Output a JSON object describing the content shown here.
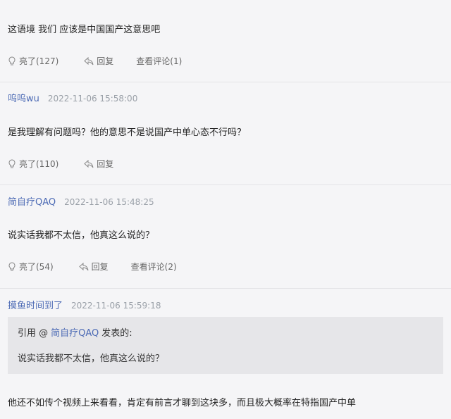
{
  "comments": [
    {
      "text": "这语境 我们 应该是中国国产这意思吧",
      "actions": {
        "like": "亮了(127)",
        "reply": "回复",
        "view": "查看评论(1)"
      }
    },
    {
      "user": "呜呜wu",
      "time": "2022-11-06 15:58:00",
      "text": "是我理解有问题吗？他的意思不是说国产中单心态不行吗？",
      "actions": {
        "like": "亮了(110)",
        "reply": "回复"
      }
    },
    {
      "user": "简自疗QAQ",
      "time": "2022-11-06 15:48:25",
      "text": "说实话我都不太信，他真这么说的？",
      "actions": {
        "like": "亮了(54)",
        "reply": "回复",
        "view": "查看评论(2)"
      }
    },
    {
      "user": "摸鱼时间到了",
      "time": "2022-11-06 15:59:18",
      "quote": {
        "prefix": "引用 @",
        "user": "简自疗QAQ",
        "suffix": "发表的:",
        "text": "说实话我都不太信，他真这么说的？"
      },
      "text": "他还不如传个视频上来看看，肯定有前言才聊到这块多，而且极大概率在特指国产中单"
    }
  ],
  "colors": {
    "username": "#4d6bb5",
    "timestamp": "#9aa0a8",
    "background": "#f5f5f7",
    "quote_bg": "#e6e6e9"
  },
  "icons": {
    "like": "lightbulb-icon",
    "reply": "reply-arrow-icon"
  }
}
